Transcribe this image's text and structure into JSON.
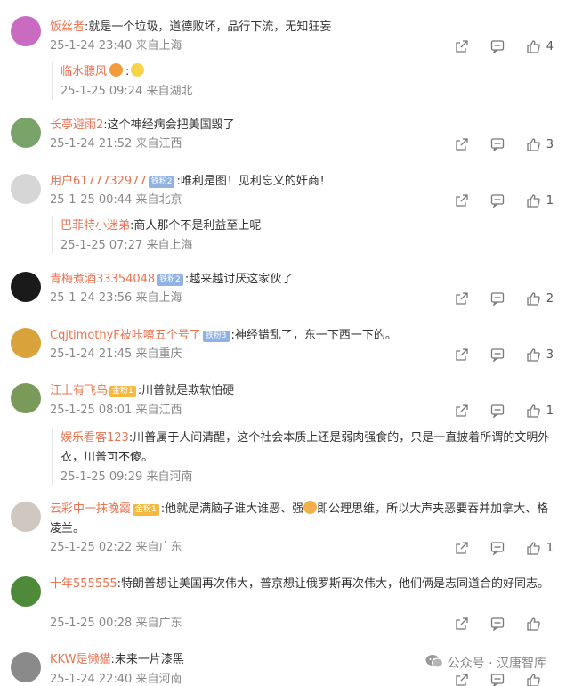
{
  "comments": [
    {
      "name": "饭丝者",
      "text": ":就是一个垃圾，道德败坏，品行下流，无知狂妄",
      "time": "25-1-24 23:40 来自上海",
      "likes": "4",
      "reply": {
        "name": "临水聽风",
        "text": ":",
        "time": "25-1-25 09:24 来自湖北"
      }
    },
    {
      "name": "长亭避雨2",
      "text": ":这个神经病会把美国毁了",
      "time": "25-1-24 21:52 来自江西",
      "likes": "3"
    },
    {
      "name": "用户6177732977",
      "badge": "铁粉2",
      "text": ":唯利是图！见利忘义的奸商！",
      "time": "25-1-25 00:44 来自北京",
      "likes": "1",
      "reply": {
        "name": "巴菲特小迷弟",
        "text": ":商人那个不是利益至上呢",
        "time": "25-1-25 07:27 来自上海"
      }
    },
    {
      "name": "青梅煮酒33354048",
      "badge": "铁粉2",
      "text": ":越来越讨厌这家伙了",
      "time": "25-1-24 23:56 来自上海",
      "likes": "2"
    },
    {
      "name": "CqjtimothyF被咔嚓五个号了",
      "badge": "铁粉3",
      "text": ":神经错乱了，东一下西一下的。",
      "time": "25-1-24 21:45 来自重庆",
      "likes": "3"
    },
    {
      "name": "江上有飞鸟",
      "badge": "金粉1",
      "text": ":川普就是欺软怕硬",
      "time": "25-1-25 08:01 来自江西",
      "likes": "1",
      "reply": {
        "name": "娱乐看客123",
        "text": ":川普属于人间清醒，这个社会本质上还是弱肉强食的，只是一直披着所谓的文明外衣，川普可不傻。",
        "time": "25-1-25 09:29 来自河南"
      }
    },
    {
      "name": "云彩中一抹晚霞",
      "badge": "金粉1",
      "text": ":他就是满脑子谁大谁恶、强",
      "text2": "即公理思维，所以大声夹恶要吞并加拿大、格凌兰。",
      "time": "25-1-25 02:22 来自广东",
      "likes": "1"
    },
    {
      "name": "十年555555",
      "text": ":特朗普想让美国再次伟大，普京想让俄罗斯再次伟大，他们俩是志同道合的好同志。",
      "time": "25-1-25 00:28 来自广东",
      "likes": ""
    },
    {
      "name": "KKW是懒猫",
      "text": ":未来一片漆黑",
      "time": "25-1-24 22:40 来自河南",
      "likes": ""
    }
  ],
  "watermark": "公众号 · 汉唐智库",
  "colors": {
    "username": "#eb7350",
    "meta": "#888888",
    "fan_badge": "#8fb1e3",
    "gold_badge": "#f5b93f"
  },
  "icons": [
    "share-icon",
    "comment-icon",
    "thumbs-up-icon",
    "wechat-icon"
  ]
}
